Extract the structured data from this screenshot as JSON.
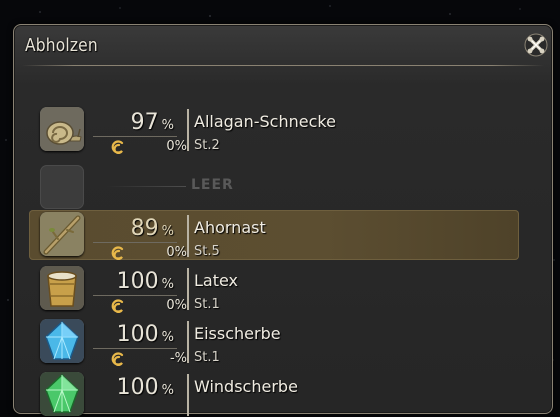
{
  "window": {
    "title": "Abholzen"
  },
  "items": [
    {
      "icon": "snail-icon",
      "pct": "97",
      "unit": "%",
      "hq_pct": "0%",
      "name": "Allagan-Schnecke",
      "level": "St.2"
    },
    {
      "empty": true,
      "label": "LEER"
    },
    {
      "icon": "branch-icon",
      "pct": "89",
      "unit": "%",
      "hq_pct": "0%",
      "name": "Ahornast",
      "level": "St.5",
      "selected": true
    },
    {
      "icon": "latex-bucket-icon",
      "pct": "100",
      "unit": "%",
      "hq_pct": "0%",
      "name": "Latex",
      "level": "St.1"
    },
    {
      "icon": "ice-shard-icon",
      "pct": "100",
      "unit": "%",
      "hq_pct": "-%",
      "name": "Eisscherbe",
      "level": "St.1"
    },
    {
      "icon": "wind-shard-icon",
      "pct": "100",
      "unit": "%",
      "name": "Windscherbe"
    }
  ],
  "colors": {
    "selected_row": "#5a4c2f",
    "text": "#f0ece2",
    "empty_text": "#595959"
  }
}
